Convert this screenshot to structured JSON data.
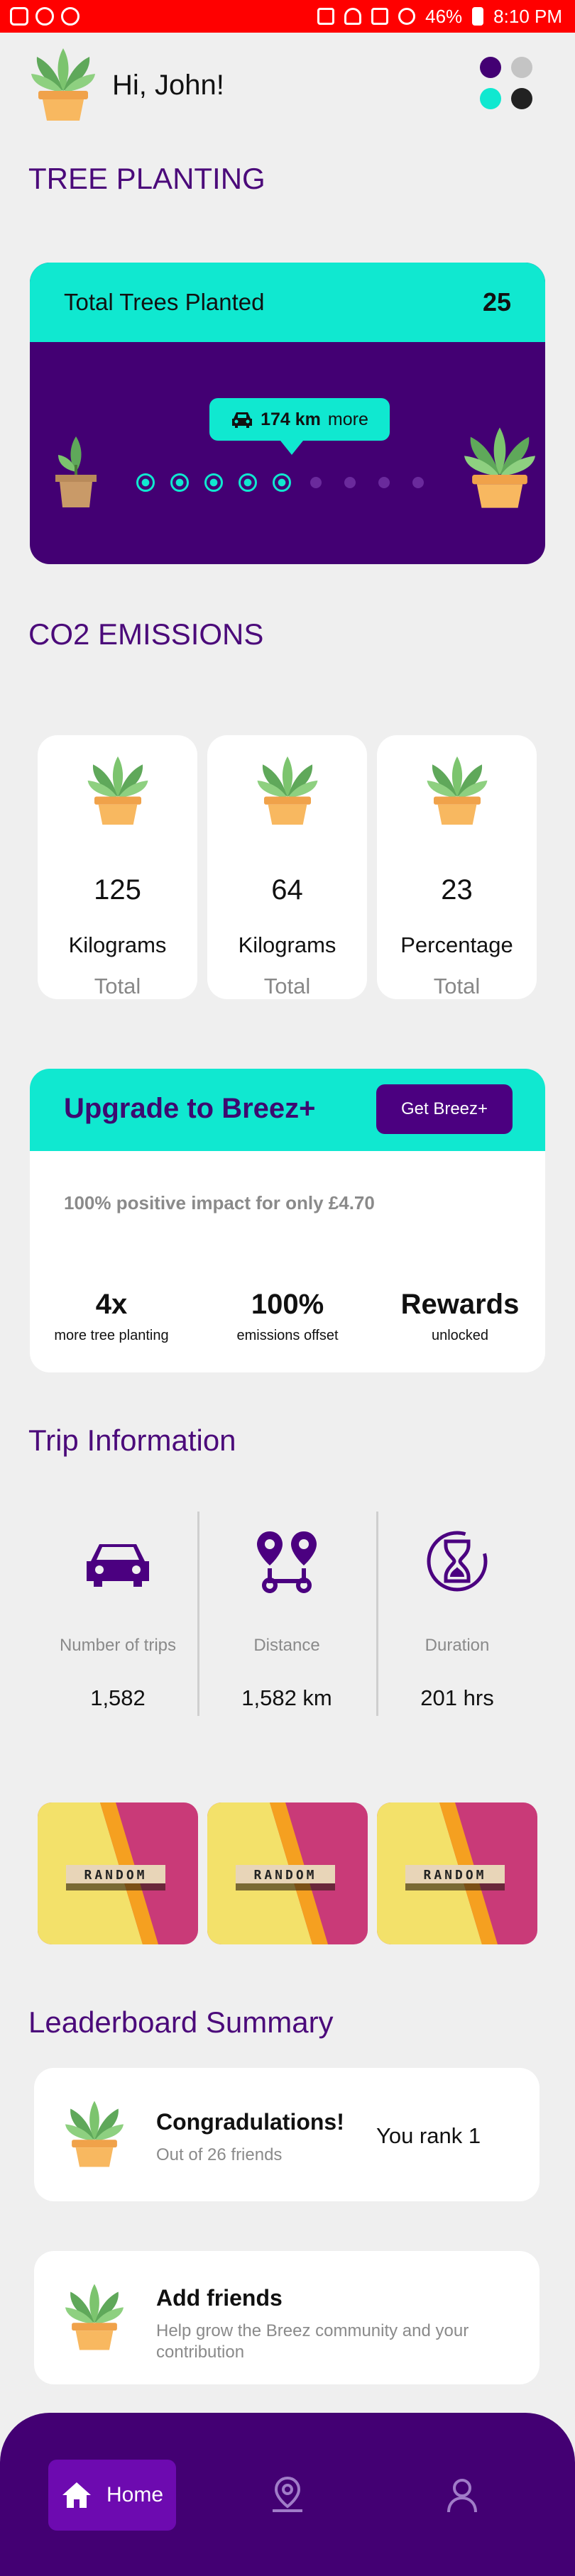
{
  "status_bar": {
    "battery": "46%",
    "time": "8:10 PM"
  },
  "header": {
    "greeting": "Hi, John!"
  },
  "colors": {
    "primary": "#4b0080",
    "accent": "#10e8d0",
    "title": "#4b0a7a"
  },
  "tree_planting": {
    "section_title": "TREE PLANTING",
    "card_label": "Total Trees Planted",
    "count": "25",
    "tooltip_distance": "174 km",
    "tooltip_suffix": "more",
    "progress": {
      "filled": 5,
      "total": 9
    }
  },
  "co2": {
    "section_title": "CO2 EMISSIONS",
    "stats": [
      {
        "value": "125",
        "unit": "Kilograms",
        "sub": "Total"
      },
      {
        "value": "64",
        "unit": "Kilograms",
        "sub": "Total"
      },
      {
        "value": "23",
        "unit": "Percentage",
        "sub": "Total"
      }
    ]
  },
  "upgrade": {
    "title": "Upgrade to Breez+",
    "button": "Get Breez+",
    "description": "100% positive impact for only £4.70",
    "features": [
      {
        "big": "4x",
        "small": "more tree planting"
      },
      {
        "big": "100%",
        "small": "emissions offset"
      },
      {
        "big": "Rewards",
        "small": "unlocked"
      }
    ]
  },
  "trip": {
    "section_title": "Trip Information",
    "items": [
      {
        "icon": "car-icon",
        "label": "Number of trips",
        "value": "1,582"
      },
      {
        "icon": "route-icon",
        "label": "Distance",
        "value": "1,582 km"
      },
      {
        "icon": "hourglass-icon",
        "label": "Duration",
        "value": "201 hrs"
      }
    ]
  },
  "random_tiles": [
    "RANDOM",
    "RANDOM",
    "RANDOM"
  ],
  "leaderboard": {
    "section_title": "Leaderboard Summary",
    "congrats_title": "Congradulations!",
    "congrats_sub": "Out of 26 friends",
    "rank_text": "You rank 1",
    "add_title": "Add friends",
    "add_sub": "Help grow the Breez community and your contribution"
  },
  "nav": {
    "home": "Home"
  }
}
